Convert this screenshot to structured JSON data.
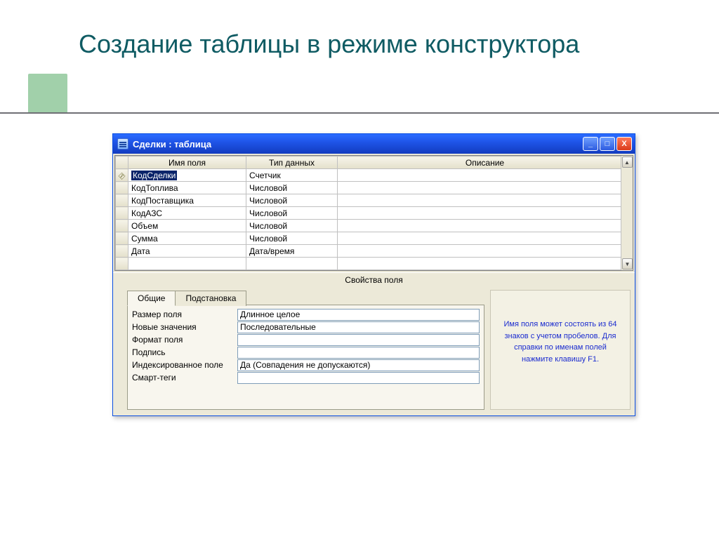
{
  "slide": {
    "title": "Создание таблицы в режиме конструктора"
  },
  "window": {
    "title": "Сделки : таблица",
    "minimize": "_",
    "maximize": "□",
    "close": "X"
  },
  "grid": {
    "headers": {
      "name": "Имя поля",
      "type": "Тип данных",
      "desc": "Описание"
    },
    "rows": [
      {
        "key": true,
        "selected": true,
        "name": "КодСделки",
        "type": "Счетчик",
        "desc": ""
      },
      {
        "key": false,
        "selected": false,
        "name": "КодТоплива",
        "type": "Числовой",
        "desc": ""
      },
      {
        "key": false,
        "selected": false,
        "name": "КодПоставщика",
        "type": "Числовой",
        "desc": ""
      },
      {
        "key": false,
        "selected": false,
        "name": "КодАЗС",
        "type": "Числовой",
        "desc": ""
      },
      {
        "key": false,
        "selected": false,
        "name": "Объем",
        "type": "Числовой",
        "desc": ""
      },
      {
        "key": false,
        "selected": false,
        "name": "Сумма",
        "type": "Числовой",
        "desc": ""
      },
      {
        "key": false,
        "selected": false,
        "name": "Дата",
        "type": "Дата/время",
        "desc": ""
      },
      {
        "key": false,
        "selected": false,
        "name": "",
        "type": "",
        "desc": ""
      }
    ]
  },
  "props": {
    "caption": "Свойства поля",
    "tabs": {
      "general": "Общие",
      "lookup": "Подстановка"
    },
    "rows": [
      {
        "label": "Размер поля",
        "value": "Длинное целое"
      },
      {
        "label": "Новые значения",
        "value": "Последовательные"
      },
      {
        "label": "Формат поля",
        "value": ""
      },
      {
        "label": "Подпись",
        "value": ""
      },
      {
        "label": "Индексированное поле",
        "value": "Да (Совпадения не допускаются)"
      },
      {
        "label": "Смарт-теги",
        "value": ""
      }
    ],
    "hint": "Имя поля может состоять из 64 знаков с учетом пробелов.  Для справки по именам полей нажмите клавишу F1."
  }
}
